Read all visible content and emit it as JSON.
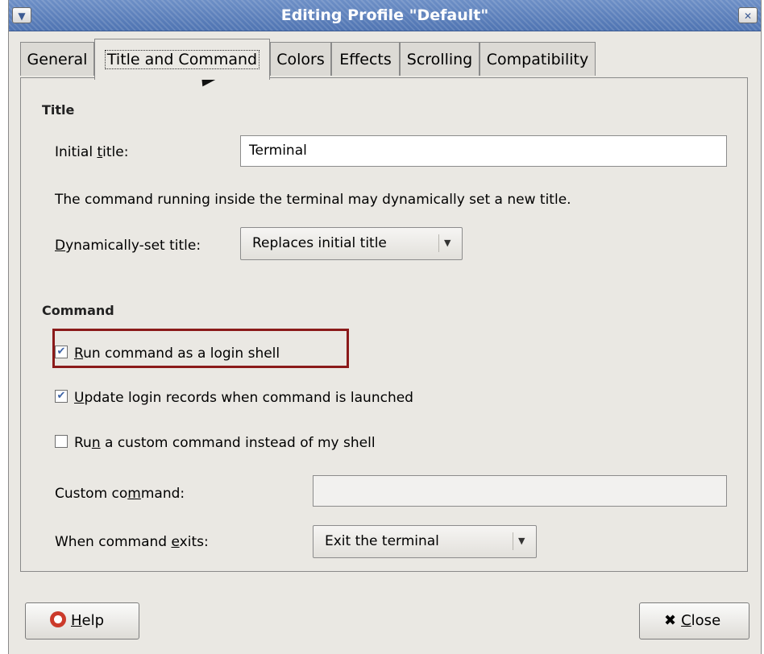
{
  "window": {
    "title": "Editing Profile \"Default\"",
    "menu_icon": "chevron-down-icon",
    "close_icon": "close-icon"
  },
  "tabs": [
    {
      "label": "General"
    },
    {
      "label": "Title and Command",
      "active": true
    },
    {
      "label": "Colors"
    },
    {
      "label": "Effects"
    },
    {
      "label": "Scrolling"
    },
    {
      "label": "Compatibility"
    }
  ],
  "title_section": {
    "heading": "Title",
    "initial_title_label": "Initial title:",
    "initial_title_value": "Terminal",
    "note": "The command running inside the terminal may dynamically set a new title.",
    "dynamic_label": "Dynamically-set title:",
    "dynamic_value": "Replaces initial title"
  },
  "command_section": {
    "heading": "Command",
    "login_shell": {
      "label": "Run command as a login shell",
      "checked": true
    },
    "update_records": {
      "label": "Update login records when command is launched",
      "checked": true
    },
    "custom_command_toggle": {
      "label": "Run a custom command instead of my shell",
      "checked": false
    },
    "custom_command_label": "Custom command:",
    "custom_command_value": "",
    "exit_label": "When command exits:",
    "exit_value": "Exit the terminal"
  },
  "buttons": {
    "help": "Help",
    "close": "Close"
  },
  "colors": {
    "highlight": "#8b1a1a",
    "titlebar": "#5a7dbb",
    "dialog_bg": "#eae8e3"
  }
}
